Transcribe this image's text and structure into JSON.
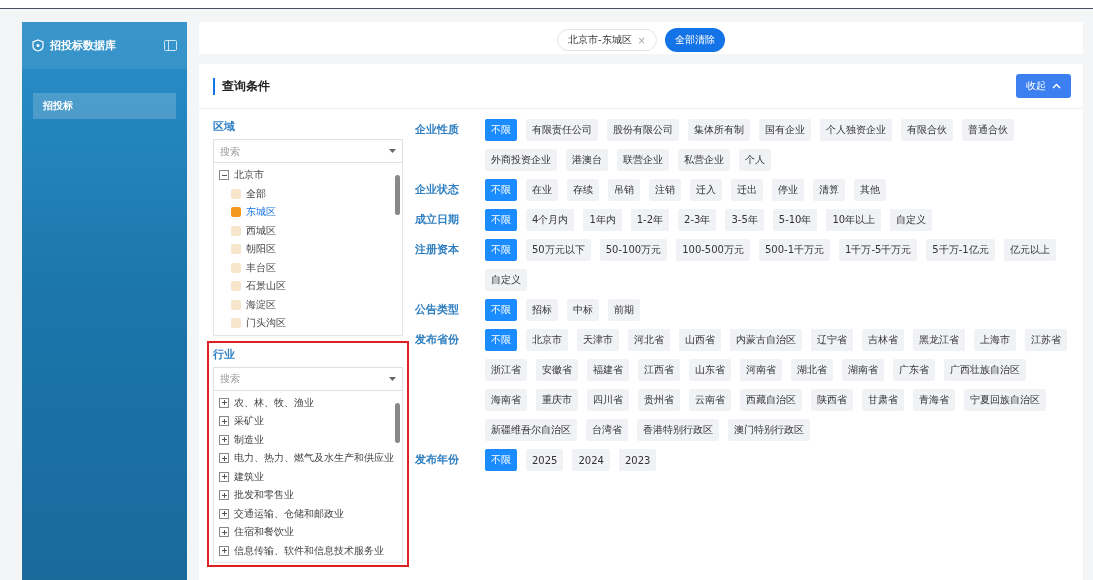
{
  "sidebar": {
    "title": "招投标数据库",
    "items": [
      {
        "label": "招投标",
        "selected": true
      }
    ]
  },
  "filter_tags": [
    {
      "label": "北京市-东城区",
      "remove": "×"
    }
  ],
  "clear_all_button": "全部清除",
  "query": {
    "title": "查询条件",
    "collapse_button": "收起"
  },
  "region": {
    "label": "区域",
    "placeholder": "搜索",
    "tree": [
      {
        "label": "北京市",
        "expanded": true,
        "children": [
          {
            "label": "全部",
            "checked": false
          },
          {
            "label": "东城区",
            "checked": true
          },
          {
            "label": "西城区",
            "checked": false
          },
          {
            "label": "朝阳区",
            "checked": false
          },
          {
            "label": "丰台区",
            "checked": false
          },
          {
            "label": "石景山区",
            "checked": false
          },
          {
            "label": "海淀区",
            "checked": false
          },
          {
            "label": "门头沟区",
            "checked": false
          }
        ]
      }
    ]
  },
  "industry": {
    "label": "行业",
    "placeholder": "搜索",
    "items": [
      {
        "label": "农、林、牧、渔业",
        "expanded": false
      },
      {
        "label": "采矿业",
        "expanded": false
      },
      {
        "label": "制造业",
        "expanded": false
      },
      {
        "label": "电力、热力、燃气及水生产和供应业",
        "expanded": false
      },
      {
        "label": "建筑业",
        "expanded": false
      },
      {
        "label": "批发和零售业",
        "expanded": false
      },
      {
        "label": "交通运输、仓储和邮政业",
        "expanded": false
      },
      {
        "label": "住宿和餐饮业",
        "expanded": false
      },
      {
        "label": "信息传输、软件和信息技术服务业",
        "expanded": false
      }
    ]
  },
  "filters": [
    {
      "label": "企业性质",
      "options": [
        {
          "label": "不限",
          "selected": true
        },
        {
          "label": "有限责任公司",
          "selected": false
        },
        {
          "label": "股份有限公司",
          "selected": false
        },
        {
          "label": "集体所有制",
          "selected": false
        },
        {
          "label": "国有企业",
          "selected": false
        },
        {
          "label": "个人独资企业",
          "selected": false
        },
        {
          "label": "有限合伙",
          "selected": false
        },
        {
          "label": "普通合伙",
          "selected": false
        },
        {
          "label": "外商投资企业",
          "selected": false
        },
        {
          "label": "港澳台",
          "selected": false
        },
        {
          "label": "联营企业",
          "selected": false
        },
        {
          "label": "私营企业",
          "selected": false
        },
        {
          "label": "个人",
          "selected": false
        }
      ]
    },
    {
      "label": "企业状态",
      "options": [
        {
          "label": "不限",
          "selected": true
        },
        {
          "label": "在业",
          "selected": false
        },
        {
          "label": "存续",
          "selected": false
        },
        {
          "label": "吊销",
          "selected": false
        },
        {
          "label": "注销",
          "selected": false
        },
        {
          "label": "迁入",
          "selected": false
        },
        {
          "label": "迁出",
          "selected": false
        },
        {
          "label": "停业",
          "selected": false
        },
        {
          "label": "清算",
          "selected": false
        },
        {
          "label": "其他",
          "selected": false
        }
      ]
    },
    {
      "label": "成立日期",
      "options": [
        {
          "label": "不限",
          "selected": true
        },
        {
          "label": "4个月内",
          "selected": false
        },
        {
          "label": "1年内",
          "selected": false
        },
        {
          "label": "1-2年",
          "selected": false
        },
        {
          "label": "2-3年",
          "selected": false
        },
        {
          "label": "3-5年",
          "selected": false
        },
        {
          "label": "5-10年",
          "selected": false
        },
        {
          "label": "10年以上",
          "selected": false
        },
        {
          "label": "自定义",
          "selected": false
        }
      ]
    },
    {
      "label": "注册资本",
      "options": [
        {
          "label": "不限",
          "selected": true
        },
        {
          "label": "50万元以下",
          "selected": false
        },
        {
          "label": "50-100万元",
          "selected": false
        },
        {
          "label": "100-500万元",
          "selected": false
        },
        {
          "label": "500-1千万元",
          "selected": false
        },
        {
          "label": "1千万-5千万元",
          "selected": false
        },
        {
          "label": "5千万-1亿元",
          "selected": false
        },
        {
          "label": "亿元以上",
          "selected": false
        },
        {
          "label": "自定义",
          "selected": false
        }
      ]
    },
    {
      "label": "公告类型",
      "options": [
        {
          "label": "不限",
          "selected": true
        },
        {
          "label": "招标",
          "selected": false
        },
        {
          "label": "中标",
          "selected": false
        },
        {
          "label": "前期",
          "selected": false
        }
      ]
    },
    {
      "label": "发布省份",
      "options": [
        {
          "label": "不限",
          "selected": true
        },
        {
          "label": "北京市",
          "selected": false
        },
        {
          "label": "天津市",
          "selected": false
        },
        {
          "label": "河北省",
          "selected": false
        },
        {
          "label": "山西省",
          "selected": false
        },
        {
          "label": "内蒙古自治区",
          "selected": false
        },
        {
          "label": "辽宁省",
          "selected": false
        },
        {
          "label": "吉林省",
          "selected": false
        },
        {
          "label": "黑龙江省",
          "selected": false
        },
        {
          "label": "上海市",
          "selected": false
        },
        {
          "label": "江苏省",
          "selected": false
        },
        {
          "label": "浙江省",
          "selected": false
        },
        {
          "label": "安徽省",
          "selected": false
        },
        {
          "label": "福建省",
          "selected": false
        },
        {
          "label": "江西省",
          "selected": false
        },
        {
          "label": "山东省",
          "selected": false
        },
        {
          "label": "河南省",
          "selected": false
        },
        {
          "label": "湖北省",
          "selected": false
        },
        {
          "label": "湖南省",
          "selected": false
        },
        {
          "label": "广东省",
          "selected": false
        },
        {
          "label": "广西壮族自治区",
          "selected": false
        },
        {
          "label": "海南省",
          "selected": false
        },
        {
          "label": "重庆市",
          "selected": false
        },
        {
          "label": "四川省",
          "selected": false
        },
        {
          "label": "贵州省",
          "selected": false
        },
        {
          "label": "云南省",
          "selected": false
        },
        {
          "label": "西藏自治区",
          "selected": false
        },
        {
          "label": "陕西省",
          "selected": false
        },
        {
          "label": "甘肃省",
          "selected": false
        },
        {
          "label": "青海省",
          "selected": false
        },
        {
          "label": "宁夏回族自治区",
          "selected": false
        },
        {
          "label": "新疆维吾尔自治区",
          "selected": false
        },
        {
          "label": "台湾省",
          "selected": false
        },
        {
          "label": "香港特别行政区",
          "selected": false
        },
        {
          "label": "澳门特别行政区",
          "selected": false
        }
      ]
    },
    {
      "label": "发布年份",
      "options": [
        {
          "label": "不限",
          "selected": true
        },
        {
          "label": "2025",
          "selected": false
        },
        {
          "label": "2024",
          "selected": false
        },
        {
          "label": "2023",
          "selected": false
        }
      ]
    }
  ]
}
